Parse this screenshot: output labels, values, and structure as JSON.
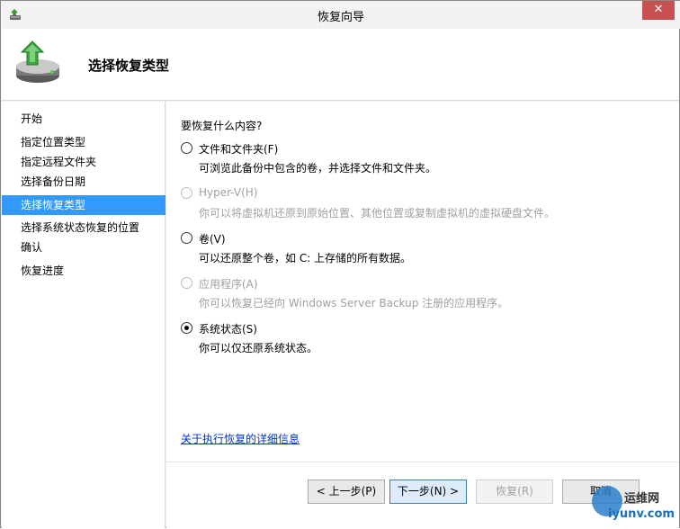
{
  "window": {
    "title": "恢复向导",
    "close_glyph": "✕"
  },
  "header": {
    "title": "选择恢复类型",
    "icon": "backup-restore-icon"
  },
  "sidebar": {
    "items": [
      {
        "label": "开始",
        "active": false
      },
      {
        "label": "指定位置类型",
        "active": false
      },
      {
        "label": "指定远程文件夹",
        "active": false
      },
      {
        "label": "选择备份日期",
        "active": false
      },
      {
        "label": "选择恢复类型",
        "active": true
      },
      {
        "label": "选择系统状态恢复的位置",
        "active": false
      },
      {
        "label": "确认",
        "active": false
      },
      {
        "label": "恢复进度",
        "active": false
      }
    ]
  },
  "main": {
    "question": "要恢复什么内容?",
    "options": [
      {
        "label": "文件和文件夹(F)",
        "description": "可浏览此备份中包含的卷，并选择文件和文件夹。",
        "enabled": true,
        "selected": false
      },
      {
        "label": "Hyper-V(H)",
        "description": "你可以将虚拟机还原到原始位置、其他位置或复制虚拟机的虚拟硬盘文件。",
        "enabled": false,
        "selected": false
      },
      {
        "label": "卷(V)",
        "description": "可以还原整个卷，如 C: 上存储的所有数据。",
        "enabled": true,
        "selected": false
      },
      {
        "label": "应用程序(A)",
        "description": "你可以恢复已经向 Windows Server Backup 注册的应用程序。",
        "enabled": false,
        "selected": false
      },
      {
        "label": "系统状态(S)",
        "description": "你可以仅还原系统状态。",
        "enabled": true,
        "selected": true
      }
    ],
    "more_info_link": "关于执行恢复的详细信息"
  },
  "footer": {
    "back_label": "< 上一步(P)",
    "next_label": "下一步(N) >",
    "recover_label": "恢复(R)",
    "cancel_label": "取消"
  },
  "watermark": {
    "line1": "运维网",
    "line2": "iyunv.com"
  }
}
